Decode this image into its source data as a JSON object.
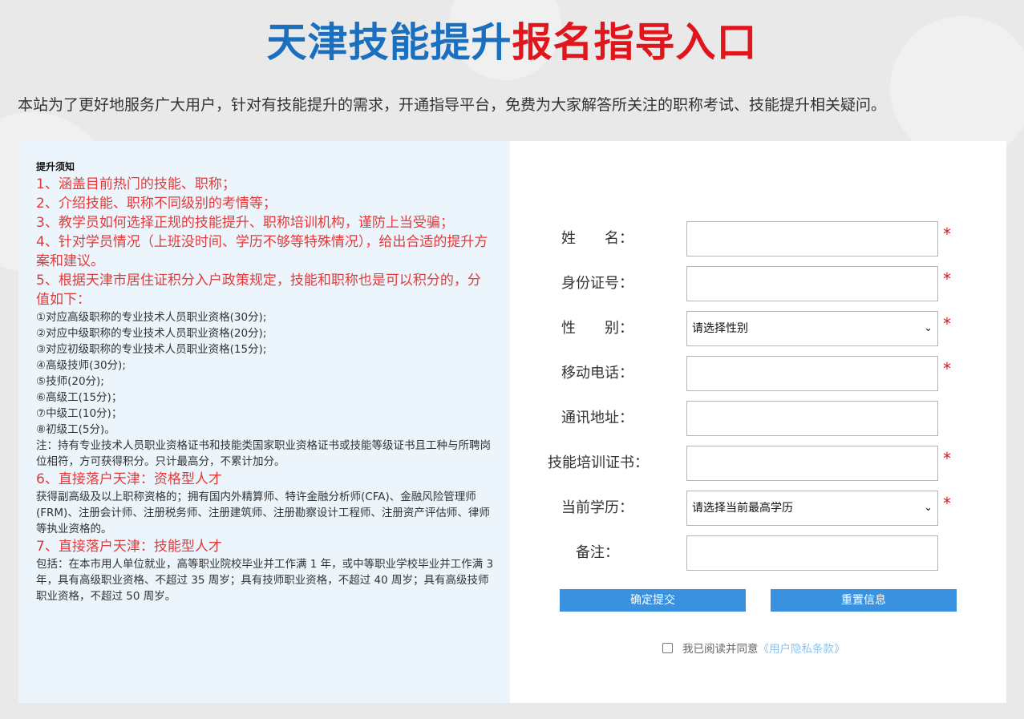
{
  "header": {
    "title_blue": "天津技能提升",
    "title_red": "报名指导入口"
  },
  "intro": "本站为了更好地服务广大用户，针对有技能提升的需求，开通指导平台，免费为大家解答所关注的职称考试、技能提升相关疑问。",
  "notice": {
    "title": "提升须知",
    "lines": [
      {
        "t": "1、涵盖目前热门的技能、职称；",
        "s": "r"
      },
      {
        "t": "2、介绍技能、职称不同级别的考情等；",
        "s": "r"
      },
      {
        "t": "3、教学员如何选择正规的技能提升、职称培训机构，谨防上当受骗；",
        "s": "r"
      },
      {
        "t": "4、针对学员情况（上班没时间、学历不够等特殊情况），给出合适的提升方案和建议。",
        "s": "r"
      },
      {
        "t": "5、根据天津市居住证积分入户政策规定，技能和职称也是可以积分的，分值如下：",
        "s": "r"
      },
      {
        "t": "①对应高级职称的专业技术人员职业资格(30分);",
        "s": "s"
      },
      {
        "t": "②对应中级职称的专业技术人员职业资格(20分);",
        "s": "s"
      },
      {
        "t": "③对应初级职称的专业技术人员职业资格(15分);",
        "s": "s"
      },
      {
        "t": "④高级技师(30分);",
        "s": "s"
      },
      {
        "t": "⑤技师(20分);",
        "s": "s"
      },
      {
        "t": "⑥高级工(15分)；",
        "s": "s"
      },
      {
        "t": "⑦中级工(10分)；",
        "s": "s"
      },
      {
        "t": "⑧初级工(5分)。",
        "s": "s"
      },
      {
        "t": "注：持有专业技术人员职业资格证书和技能类国家职业资格证书或技能等级证书且工种与所聘岗位相符，方可获得积分。只计最高分，不累计加分。",
        "s": "s"
      },
      {
        "t": "6、直接落户天津：资格型人才",
        "s": "r"
      },
      {
        "t": "获得副高级及以上职称资格的；拥有国内外精算师、特许金融分析师(CFA)、金融风险管理师(FRM)、注册会计师、注册税务师、注册建筑师、注册勘察设计工程师、注册资产评估师、律师等执业资格的。",
        "s": "s"
      },
      {
        "t": "7、直接落户天津：技能型人才",
        "s": "r"
      },
      {
        "t": "包括：在本市用人单位就业，高等职业院校毕业并工作满 1 年，或中等职业学校毕业并工作满 3 年，具有高级职业资格、不超过 35 周岁；具有技师职业资格，不超过 40 周岁；具有高级技师职业资格，不超过 50 周岁。",
        "s": "s"
      }
    ]
  },
  "form": {
    "required_mark": "*",
    "fields": {
      "name": {
        "label": "姓　　名：",
        "value": ""
      },
      "idcard": {
        "label": "身份证号：",
        "value": ""
      },
      "gender": {
        "label": "性　　别：",
        "selected": "请选择性别"
      },
      "phone": {
        "label": "移动电话：",
        "value": ""
      },
      "address": {
        "label": "通讯地址：",
        "value": ""
      },
      "certificate": {
        "label": "技能培训证书：",
        "value": ""
      },
      "education": {
        "label": "当前学历：",
        "selected": "请选择当前最高学历"
      },
      "remark": {
        "label": "备注：",
        "value": ""
      }
    },
    "submit_label": "确定提交",
    "reset_label": "重置信息",
    "agree_text": "我已阅读并同意",
    "agree_link": "《用户隐私条款》",
    "agree_checked": false
  }
}
